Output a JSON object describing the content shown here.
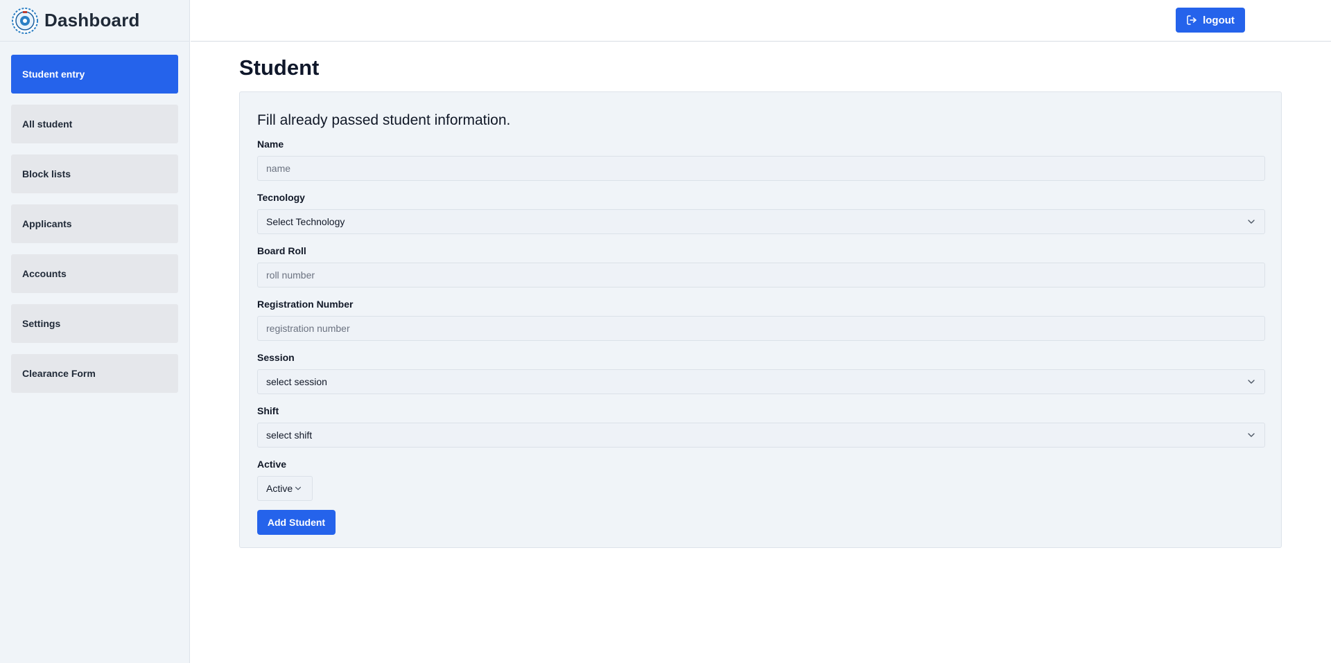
{
  "sidebar": {
    "brand_title": "Dashboard",
    "logo_icon": "college-emblem-icon",
    "items": [
      {
        "label": "Student entry",
        "active": true
      },
      {
        "label": "All student",
        "active": false
      },
      {
        "label": "Block lists",
        "active": false
      },
      {
        "label": "Applicants",
        "active": false
      },
      {
        "label": "Accounts",
        "active": false
      },
      {
        "label": "Settings",
        "active": false
      },
      {
        "label": "Clearance Form",
        "active": false
      }
    ]
  },
  "topbar": {
    "logout_label": "logout",
    "logout_icon": "logout-icon"
  },
  "main": {
    "page_title": "Student",
    "form": {
      "heading": "Fill already passed student information.",
      "name": {
        "label": "Name",
        "placeholder": "name",
        "value": ""
      },
      "technology": {
        "label": "Tecnology",
        "selected": "Select Technology"
      },
      "board_roll": {
        "label": "Board Roll",
        "placeholder": "roll number",
        "value": ""
      },
      "registration": {
        "label": "Registration Number",
        "placeholder": "registration number",
        "value": ""
      },
      "session": {
        "label": "Session",
        "selected": "select session"
      },
      "shift": {
        "label": "Shift",
        "selected": "select shift"
      },
      "active": {
        "label": "Active",
        "selected": "Active"
      },
      "submit_label": "Add Student"
    }
  },
  "colors": {
    "accent": "#2563eb",
    "sidebar_bg": "#f0f4f8",
    "nav_item_bg": "#e5e7eb",
    "card_bg": "#f0f4f8"
  }
}
